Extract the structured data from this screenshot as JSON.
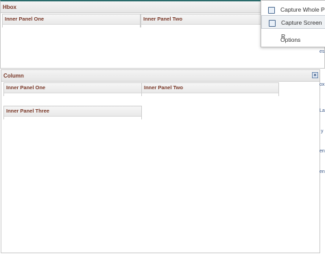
{
  "hbox": {
    "title": "Hbox",
    "panels": [
      "Inner Panel One",
      "Inner Panel Two"
    ]
  },
  "column": {
    "title": "Column",
    "panels": [
      "Inner Panel One",
      "Inner Panel Two",
      "Inner Panel Three"
    ],
    "close_icon": "close-icon"
  },
  "menu": {
    "items": [
      "Capture Whole Pa",
      "Capture Screen R",
      "Options"
    ]
  },
  "background_fragments": [
    "es",
    "ox",
    "La",
    "y",
    "en",
    "en"
  ]
}
